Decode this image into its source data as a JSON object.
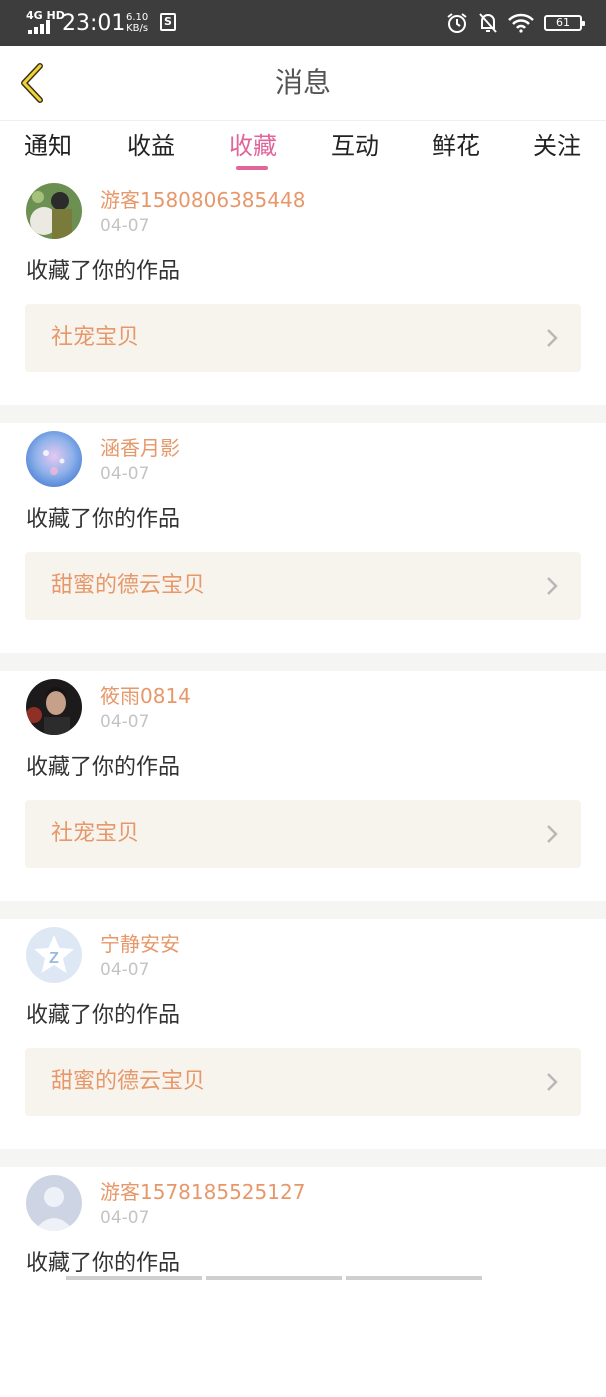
{
  "status_bar": {
    "network": "4G HD",
    "time": "23:01",
    "speed_value": "6.10",
    "speed_unit": "KB/s",
    "s_badge": "S",
    "battery": "61",
    "icons": [
      "signal-icon",
      "alarm-icon",
      "notifications-off-icon",
      "wifi-icon",
      "battery-icon"
    ]
  },
  "header": {
    "title": "消息",
    "back_icon": "chevron-left-icon"
  },
  "tabs": [
    {
      "label": "通知",
      "active": false
    },
    {
      "label": "收益",
      "active": false
    },
    {
      "label": "收藏",
      "active": true
    },
    {
      "label": "互动",
      "active": false
    },
    {
      "label": "鲜花",
      "active": false
    },
    {
      "label": "关注",
      "active": false
    }
  ],
  "colors": {
    "accent": "#e0659b",
    "username": "#e7986a",
    "work_box_bg": "#f7f4ee",
    "date": "#c4c4c4"
  },
  "messages": [
    {
      "username": "游客1580806385448",
      "date": "04-07",
      "action": "收藏了你的作品",
      "work": "社宠宝贝",
      "avatar": "photo-avatar-1"
    },
    {
      "username": "涵香月影",
      "date": "04-07",
      "action": "收藏了你的作品",
      "work": "甜蜜的德云宝贝",
      "avatar": "photo-avatar-2"
    },
    {
      "username": "筱雨0814",
      "date": "04-07",
      "action": "收藏了你的作品",
      "work": "社宠宝贝",
      "avatar": "photo-avatar-3"
    },
    {
      "username": "宁静安安",
      "date": "04-07",
      "action": "收藏了你的作品",
      "work": "甜蜜的德云宝贝",
      "avatar": "default-avatar-logo"
    },
    {
      "username": "游客1578185525127",
      "date": "04-07",
      "action": "收藏了你的作品",
      "work": "",
      "avatar": "default-avatar-silhouette"
    }
  ]
}
